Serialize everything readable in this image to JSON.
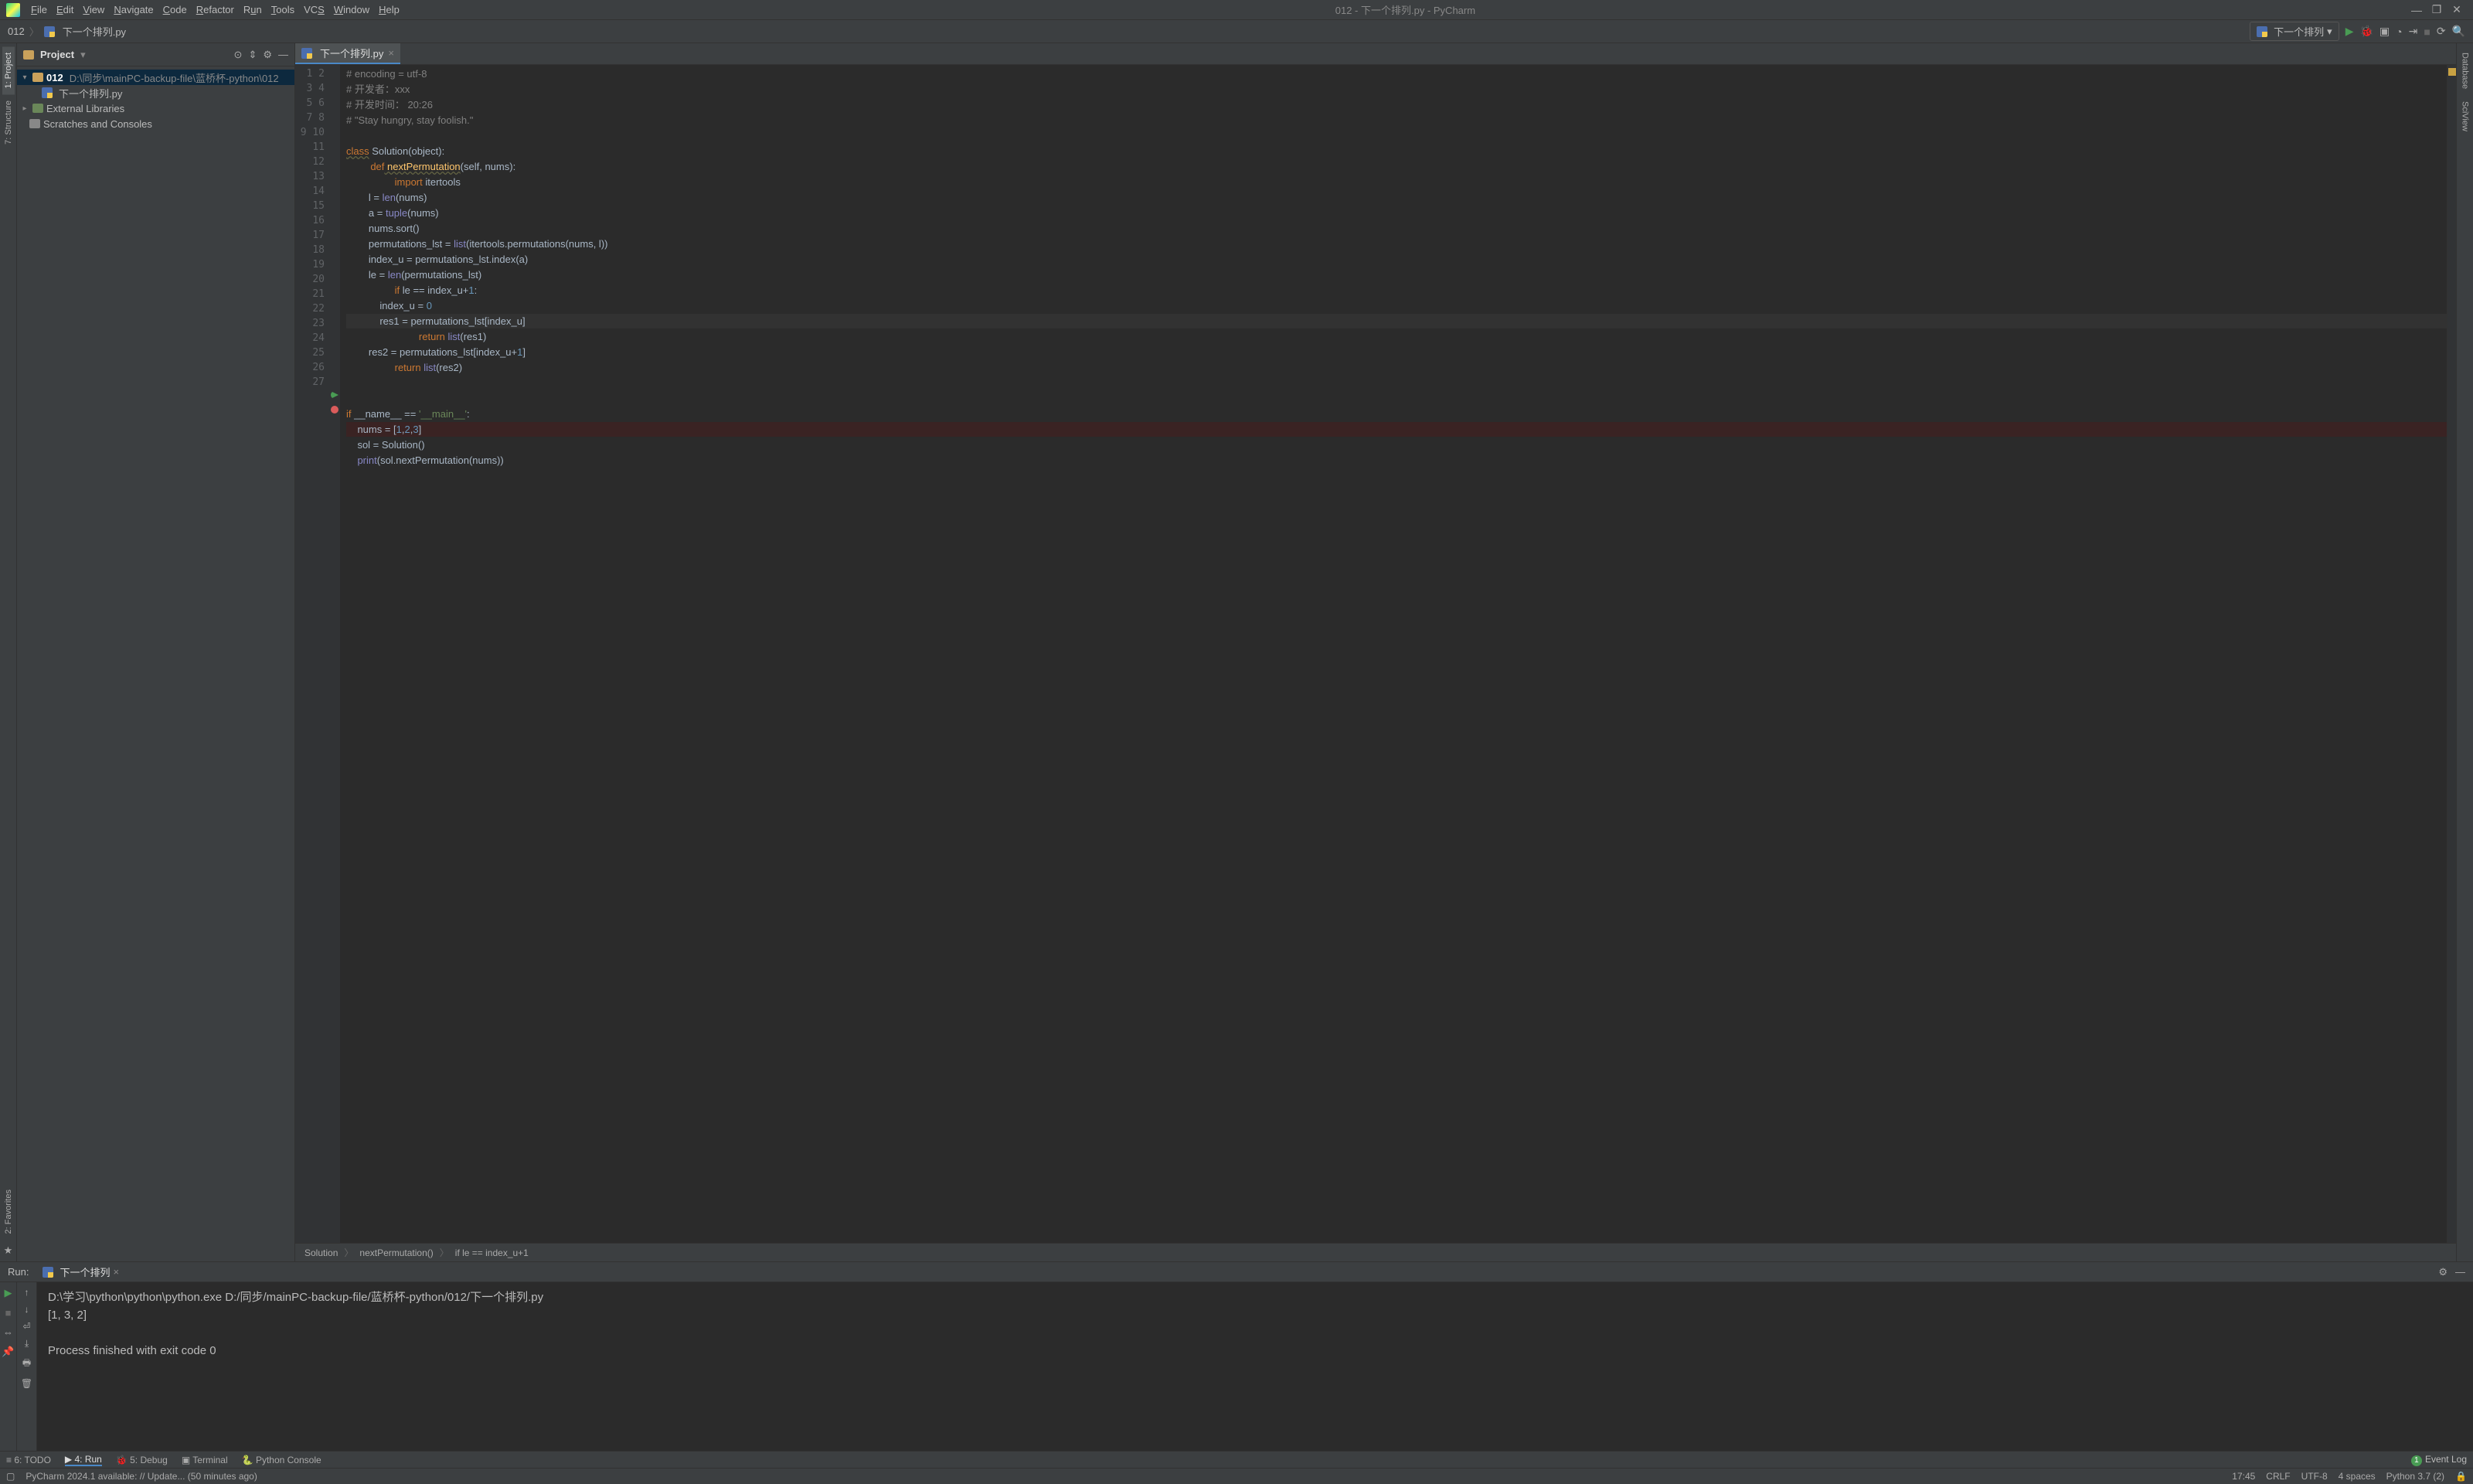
{
  "title_bar": {
    "title": "012 - 下一个排列.py - PyCharm"
  },
  "menu": {
    "file": "File",
    "edit": "Edit",
    "view": "View",
    "navigate": "Navigate",
    "code": "Code",
    "refactor": "Refactor",
    "run": "Run",
    "tools": "Tools",
    "vcs": "VCS",
    "window": "Window",
    "help": "Help"
  },
  "nav": {
    "crumb1": "012",
    "crumb2": "下一个排列.py",
    "run_config": "下一个排列"
  },
  "left_tabs": {
    "project": "1: Project",
    "structure": "7: Structure",
    "favorites": "2: Favorites"
  },
  "right_tabs": {
    "database": "Database",
    "sciview": "SciView"
  },
  "project": {
    "header": "Project",
    "root": "012",
    "root_path": "D:\\同步\\mainPC-backup-file\\蓝桥杯-python\\012",
    "file": "下一个排列.py",
    "ext_lib": "External Libraries",
    "scratches": "Scratches and Consoles"
  },
  "tabs": {
    "file": "下一个排列.py"
  },
  "code": {
    "l1": "# encoding = utf-8",
    "l2": "# 开发者：xxx",
    "l3": "# 开发时间： 20:26",
    "l4": "# \"Stay hungry, stay foolish.\"",
    "l5": "",
    "l6_class": "class",
    "l6_name": " Solution",
    "l6_obj": "(object)",
    "l6_colon": ":",
    "l7_def": "def",
    "l7_fn": " nextPermutation",
    "l7_par": "(self, nums):",
    "l8_imp": "import",
    "l8_mod": " itertools",
    "l9_pre": "        l = ",
    "l9_bi": "len",
    "l9_rest": "(nums)",
    "l10_pre": "        a = ",
    "l10_bi": "tuple",
    "l10_rest": "(nums)",
    "l11": "        nums.sort()",
    "l12_pre": "        permutations_lst = ",
    "l12_bi": "list",
    "l12_rest": "(itertools.permutations(nums, l))",
    "l13": "        index_u = permutations_lst.index(a)",
    "l14_pre": "        le = ",
    "l14_bi": "len",
    "l14_rest": "(permutations_lst)",
    "l15_if": "if",
    "l15_rest": " le == index_u+",
    "l15_num": "1",
    "l15_colon": ":",
    "l16_pre": "            index_u = ",
    "l16_num": "0",
    "l17": "            res1 = permutations_lst[index_u]",
    "l18_ret": "return",
    "l18_bi": " list",
    "l18_rest": "(res1)",
    "l19_pre": "        res2 = permutations_lst[index_u+",
    "l19_num": "1",
    "l19_rest": "]",
    "l20_ret": "return",
    "l20_bi": " list",
    "l20_rest": "(res2)",
    "l21": "",
    "l22": "",
    "l23_if": "if",
    "l23_name": " __name__ == ",
    "l23_str": "'__main__'",
    "l23_colon": ":",
    "l24_pre": "    nums = [",
    "l24_n1": "1",
    "l24_c": ",",
    "l24_n2": "2",
    "l24_n3": "3",
    "l24_end": "]",
    "l25": "    sol = Solution()",
    "l26_pre": "    ",
    "l26_bi": "print",
    "l26_rest": "(sol.nextPermutation(nums))",
    "l27": ""
  },
  "breadcrumb": {
    "a": "Solution",
    "b": "nextPermutation()",
    "c": "if le == index_u+1"
  },
  "run_panel": {
    "label": "Run:",
    "tab": "下一个排列",
    "line1": "D:\\学习\\python\\python\\python.exe D:/同步/mainPC-backup-file/蓝桥杯-python/012/下一个排列.py",
    "line2": "[1, 3, 2]",
    "line3": "",
    "line4": "Process finished with exit code 0"
  },
  "bottom": {
    "todo": "6: TODO",
    "run": "4: Run",
    "debug": "5: Debug",
    "terminal": "Terminal",
    "python_console": "Python Console",
    "event_log": "Event Log",
    "badge": "1"
  },
  "status": {
    "msg": "PyCharm 2024.1 available: // Update... (50 minutes ago)",
    "pos": "17:45",
    "crlf": "CRLF",
    "enc": "UTF-8",
    "indent": "4 spaces",
    "interp": "Python 3.7 (2)"
  }
}
